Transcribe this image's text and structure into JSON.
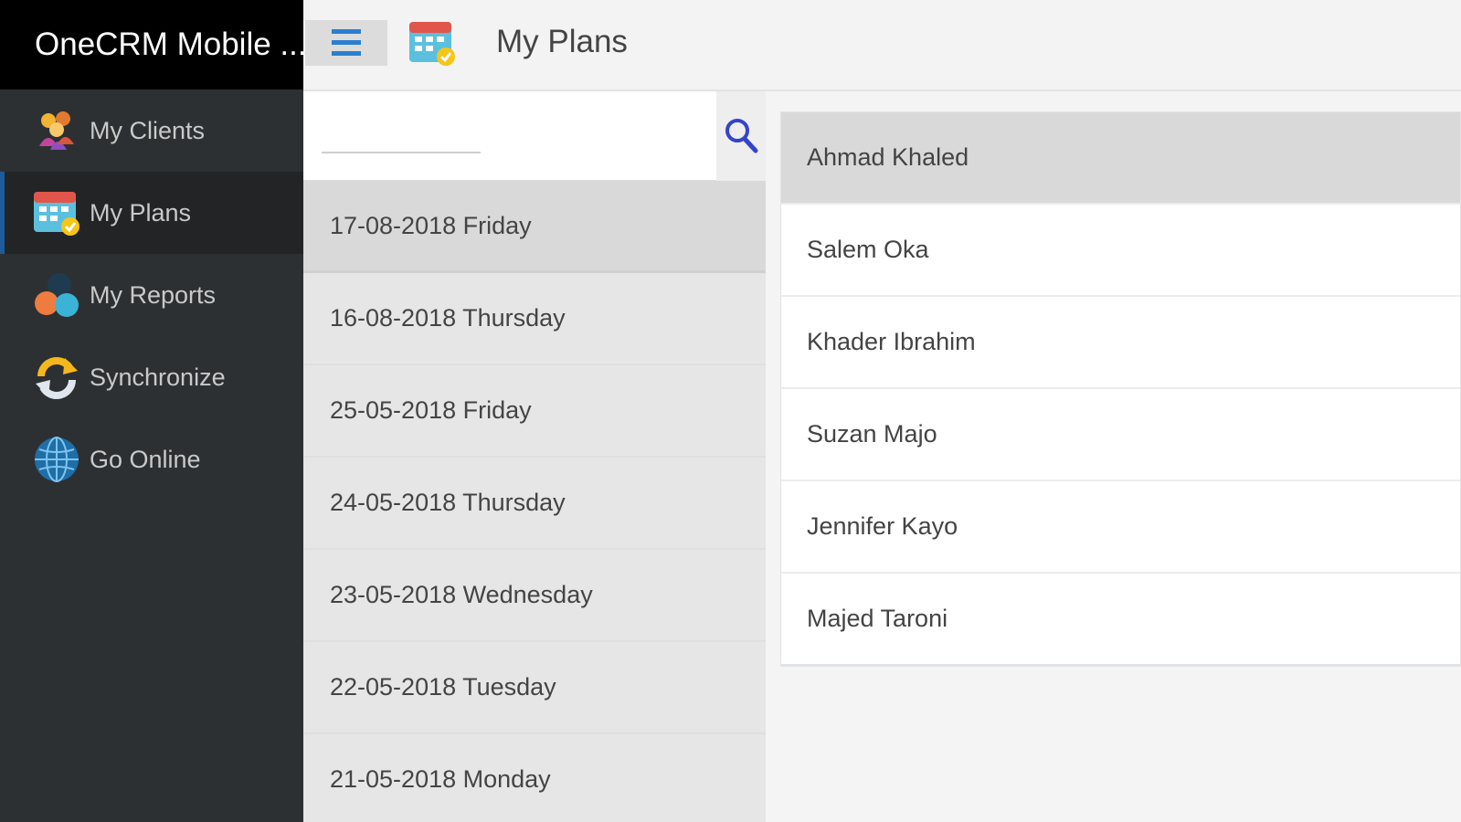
{
  "app": {
    "title": "OneCRM Mobile ..."
  },
  "sidebar": {
    "items": [
      {
        "label": "My Clients",
        "icon": "clients-icon"
      },
      {
        "label": "My Plans",
        "icon": "calendar-icon",
        "active": true
      },
      {
        "label": "My Reports",
        "icon": "reports-icon"
      },
      {
        "label": "Synchronize",
        "icon": "sync-icon"
      },
      {
        "label": "Go Online",
        "icon": "globe-icon"
      }
    ]
  },
  "header": {
    "title": "My Plans",
    "menu_icon": "hamburger-icon",
    "page_icon": "calendar-icon"
  },
  "search": {
    "value": "",
    "icon": "search-icon"
  },
  "dates": [
    "17-08-2018 Friday",
    "16-08-2018 Thursday",
    "25-05-2018 Friday",
    "24-05-2018 Thursday",
    "23-05-2018 Wednesday",
    "22-05-2018 Tuesday",
    "21-05-2018 Monday"
  ],
  "selected_date_index": 0,
  "clients": [
    "Ahmad Khaled",
    "Salem Oka",
    "Khader Ibrahim",
    "Suzan Majo",
    "Jennifer Kayo",
    "Majed Taroni"
  ],
  "selected_client_index": 0,
  "colors": {
    "sidebar_bg": "#2d3033",
    "title_bar_bg": "#000000",
    "accent": "#1d5b9a",
    "search_icon": "#3344cc"
  }
}
